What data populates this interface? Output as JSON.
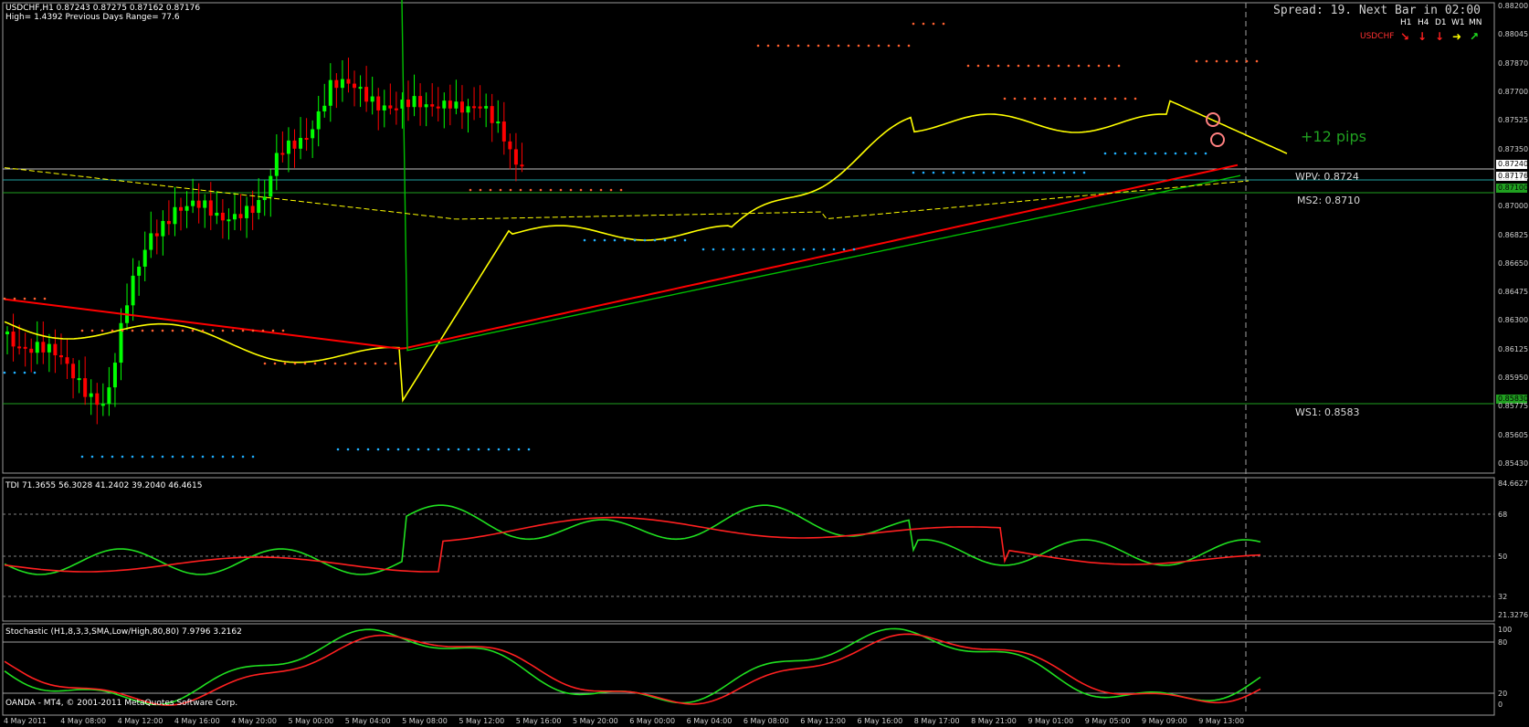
{
  "header": {
    "symbol_line": "USDCHF,H1  0.87243 0.87275 0.87162 0.87176",
    "range_line": "High= 1.4392    Previous Days Range= 77.6",
    "spread_text": "Spread: 19. Next Bar in 02:00",
    "mtf_labels": [
      "H1",
      "H4",
      "D1",
      "W1",
      "MN"
    ],
    "mtf_symbol": "USDCHF",
    "mtf_arrows": [
      {
        "glyph": "↘",
        "color": "#ff2020"
      },
      {
        "glyph": "↓",
        "color": "#ff2020"
      },
      {
        "glyph": "↓",
        "color": "#ff2020"
      },
      {
        "glyph": "➜",
        "color": "#ffff00"
      },
      {
        "glyph": "↗",
        "color": "#20e020"
      }
    ]
  },
  "main_chart": {
    "price_axis": [
      "0.88200",
      "0.88045",
      "0.87870",
      "0.87700",
      "0.87525",
      "0.87350",
      "0.87176",
      "0.87000",
      "0.86825",
      "0.86650",
      "0.86475",
      "0.86300",
      "0.86125",
      "0.85950",
      "0.85775",
      "0.85605",
      "0.85430"
    ],
    "current_price_tag": "0.87176",
    "wpv_price_tag": "0.87240",
    "ms2_price_tag": "0.87100",
    "ws1_price_tag": "0.85830",
    "levels": [
      {
        "name": "WPV",
        "label": "WPV:  0.8724",
        "price": 0.8724
      },
      {
        "name": "MS2",
        "label": "MS2:  0.8710",
        "price": 0.871
      },
      {
        "name": "WS1",
        "label": "WS1:  0.8583",
        "price": 0.8583
      }
    ],
    "annotation": "+12 pips",
    "colors": {
      "bull": "#00ff00",
      "bear": "#ff0000",
      "ma_fast": "#ffff00",
      "ma_slow": "#00c000",
      "ma_red": "#ff0000",
      "dots_up": "#ff6030",
      "dots_down": "#20b0ff"
    }
  },
  "tdi_panel": {
    "title": "TDI 71.3655 56.3028 41.2402 39.2040 46.4615",
    "axis": [
      "84.6627",
      "68",
      "50",
      "32",
      "21.3276"
    ]
  },
  "stoch_panel": {
    "title": "Stochastic (H1,8,3,3,SMA,Low/High,80,80) 7.9796 3.2162",
    "axis": [
      "100",
      "80",
      "20",
      "0"
    ],
    "copyright": "OANDA - MT4, © 2001-2011 MetaQuotes Software Corp."
  },
  "time_axis": [
    "4 May 2011",
    "4 May 08:00",
    "4 May 12:00",
    "4 May 16:00",
    "4 May 20:00",
    "5 May 00:00",
    "5 May 04:00",
    "5 May 08:00",
    "5 May 12:00",
    "5 May 16:00",
    "5 May 20:00",
    "6 May 00:00",
    "6 May 04:00",
    "6 May 08:00",
    "6 May 12:00",
    "6 May 16:00",
    "8 May 17:00",
    "8 May 21:00",
    "9 May 01:00",
    "9 May 05:00",
    "9 May 09:00",
    "9 May 13:00"
  ]
}
